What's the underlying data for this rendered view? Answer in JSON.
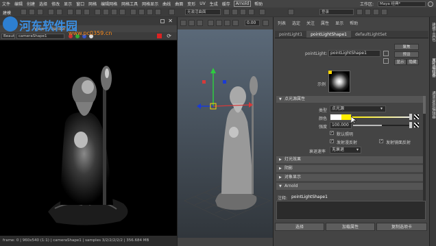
{
  "menubar": {
    "items": [
      "文件",
      "编辑",
      "创建",
      "选择",
      "修改",
      "显示",
      "窗口",
      "网格",
      "编辑网格",
      "网格工具",
      "网格显示",
      "曲线",
      "曲面",
      "变形",
      "UV",
      "生成",
      "缓存"
    ],
    "arnold": "Arnold",
    "help": "帮助",
    "workspace_label": "工作区:",
    "workspace_value": "Maya 经典*"
  },
  "toolbar": {
    "mode_label": "建模",
    "object_field": "无激活曲面",
    "login_label": "登录"
  },
  "render_view": {
    "menu": [
      "View",
      "Render"
    ],
    "beauty": "Beaut",
    "camera": "cameraShape1",
    "ratio": "0.00",
    "status": "frame: 0 | 960x540 (1:1) | cameraShape1 | samples 3/2/2/2/2/2 | 356.684 MB"
  },
  "viewport": {
    "zoom_value": "0.00"
  },
  "attribute_editor": {
    "menu": [
      "列表",
      "选定",
      "关注",
      "属性",
      "显示",
      "帮助"
    ],
    "tabs": [
      "pointLight1",
      "pointLightShape1",
      "defaultLightSet"
    ],
    "active_tab": "pointLightShape1",
    "node_label": "pointLight:",
    "node_value": "pointLightShape1",
    "btn_focus": "聚焦",
    "btn_preset": "预设",
    "btn_show": "显示",
    "btn_hide": "隐藏",
    "sample_label": "示例",
    "section_attrs": "点光源属性",
    "type_label": "类型",
    "type_value": "点光源",
    "color_label": "颜色",
    "intensity_label": "强度",
    "intensity_value": "100.000",
    "default_light": "默认照明",
    "emit_diffuse": "发射漫反射",
    "emit_specular": "发射镜面反射",
    "decay_label": "衰退速率",
    "decay_value": "无衰退",
    "section_light_effects": "灯光效果",
    "section_shadows": "阴影",
    "section_object_display": "对象显示",
    "section_arnold": "Arnold",
    "notes_label": "注释:",
    "notes_value": "pointLightShape1",
    "btn_select": "选择",
    "btn_load_attrs": "加载属性",
    "btn_copy_tab": "复制选项卡",
    "light_color": "#ffee00",
    "intensity_fraction": 0.5
  },
  "side_tabs": [
    "建模工具包",
    "属性编辑器",
    "通道盒/层编辑器"
  ],
  "watermark": {
    "text": "河东软件园",
    "url": "www.pc0359.cn"
  }
}
